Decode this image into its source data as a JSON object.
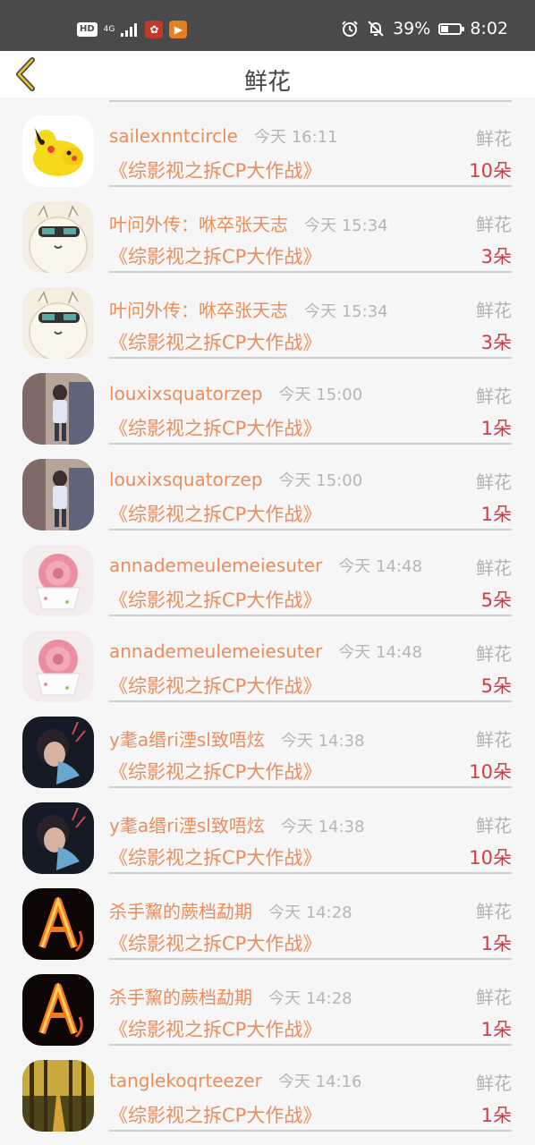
{
  "status": {
    "hd": "HD",
    "network": "4G",
    "icons": [
      "hd-badge",
      "signal-icon",
      "app-notification-icon",
      "media-app-icon"
    ],
    "battery": "39%",
    "battery_level": 0.39,
    "time": "8:02"
  },
  "nav": {
    "title": "鲜花",
    "back_icon": "chevron-left-icon"
  },
  "colors": {
    "name": "#e88d5b",
    "count": "#d9383d",
    "muted": "#b1b1b1"
  },
  "rows": [
    {
      "name": "sailexnntcircle",
      "time": "今天 16:11",
      "gift": "鲜花",
      "show": "《综影视之拆CP大作战》",
      "count": "10朵",
      "avatar": "pikachu-avatar"
    },
    {
      "name": "叶问外传：咻卒张天志",
      "time": "今天 15:34",
      "gift": "鲜花",
      "show": "《综影视之拆CP大作战》",
      "count": "3朵",
      "avatar": "alpaca-sunglasses-avatar"
    },
    {
      "name": "叶问外传：咻卒张天志",
      "time": "今天 15:34",
      "gift": "鲜花",
      "show": "《综影视之拆CP大作战》",
      "count": "3朵",
      "avatar": "alpaca-sunglasses-avatar"
    },
    {
      "name": "louxixsquatorzep",
      "time": "今天 15:00",
      "gift": "鲜花",
      "show": "《综影视之拆CP大作战》",
      "count": "1朵",
      "avatar": "street-photo-avatar"
    },
    {
      "name": "louxixsquatorzep",
      "time": "今天 15:00",
      "gift": "鲜花",
      "show": "《综影视之拆CP大作战》",
      "count": "1朵",
      "avatar": "street-photo-avatar"
    },
    {
      "name": "annademeulemeiesuter",
      "time": "今天 14:48",
      "gift": "鲜花",
      "show": "《综影视之拆CP大作战》",
      "count": "5朵",
      "avatar": "rose-cup-avatar"
    },
    {
      "name": "annademeulemeiesuter",
      "time": "今天 14:48",
      "gift": "鲜花",
      "show": "《综影视之拆CP大作战》",
      "count": "5朵",
      "avatar": "rose-cup-avatar"
    },
    {
      "name": "y耄a缗ri湮sl致唔炫",
      "time": "今天 14:38",
      "gift": "鲜花",
      "show": "《综影视之拆CP大作战》",
      "count": "10朵",
      "avatar": "dark-portrait-avatar"
    },
    {
      "name": "y耄a缗ri湮sl致唔炫",
      "time": "今天 14:38",
      "gift": "鲜花",
      "show": "《综影视之拆CP大作战》",
      "count": "10朵",
      "avatar": "dark-portrait-avatar"
    },
    {
      "name": "杀手黧的蕨档勐期",
      "time": "今天 14:28",
      "gift": "鲜花",
      "show": "《综影视之拆CP大作战》",
      "count": "1朵",
      "avatar": "fire-letter-avatar"
    },
    {
      "name": "杀手黧的蕨档勐期",
      "time": "今天 14:28",
      "gift": "鲜花",
      "show": "《综影视之拆CP大作战》",
      "count": "1朵",
      "avatar": "fire-letter-avatar"
    },
    {
      "name": "tanglekoqrteezer",
      "time": "今天 14:16",
      "gift": "鲜花",
      "show": "《综影视之拆CP大作战》",
      "count": "1朵",
      "avatar": "forest-path-avatar"
    }
  ]
}
